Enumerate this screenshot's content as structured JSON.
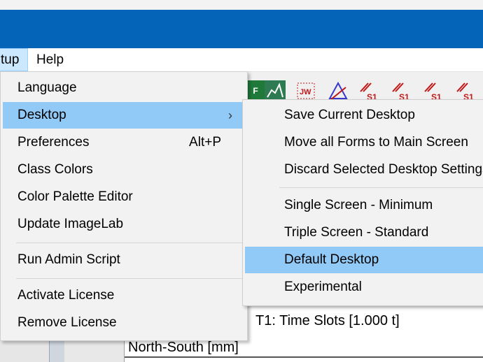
{
  "menubar": {
    "setup_label": "tup",
    "help_label": "Help"
  },
  "setup_menu": {
    "language": "Language",
    "desktop": "Desktop",
    "preferences": "Preferences",
    "preferences_shortcut": "Alt+P",
    "class_colors": "Class Colors",
    "color_palette_editor": "Color Palette Editor",
    "update_imagelab": "Update ImageLab",
    "run_admin_script": "Run Admin Script",
    "activate_license": "Activate License",
    "remove_license": "Remove License"
  },
  "desktop_menu": {
    "save_current": "Save Current Desktop",
    "move_all_forms": "Move all Forms to Main Screen",
    "discard_selected": "Discard Selected Desktop Settings",
    "single_screen": "Single Screen - Minimum",
    "triple_screen": "Triple Screen - Standard",
    "default_desktop": "Default Desktop",
    "experimental": "Experimental"
  },
  "panel": {
    "t1_label": "T1: Time Slots [1.000 t]",
    "ns_label": "North-South [mm]"
  },
  "toolbar_icons": [
    "f-icon",
    "chart-icon",
    "jw-icon",
    "delta-icon",
    "s1-icon",
    "s1-icon",
    "s1-icon",
    "s1-icon"
  ],
  "colors": {
    "titlebar": "#0364b8",
    "highlight": "#91c9f7",
    "menu_bg": "#f2f2f2"
  }
}
